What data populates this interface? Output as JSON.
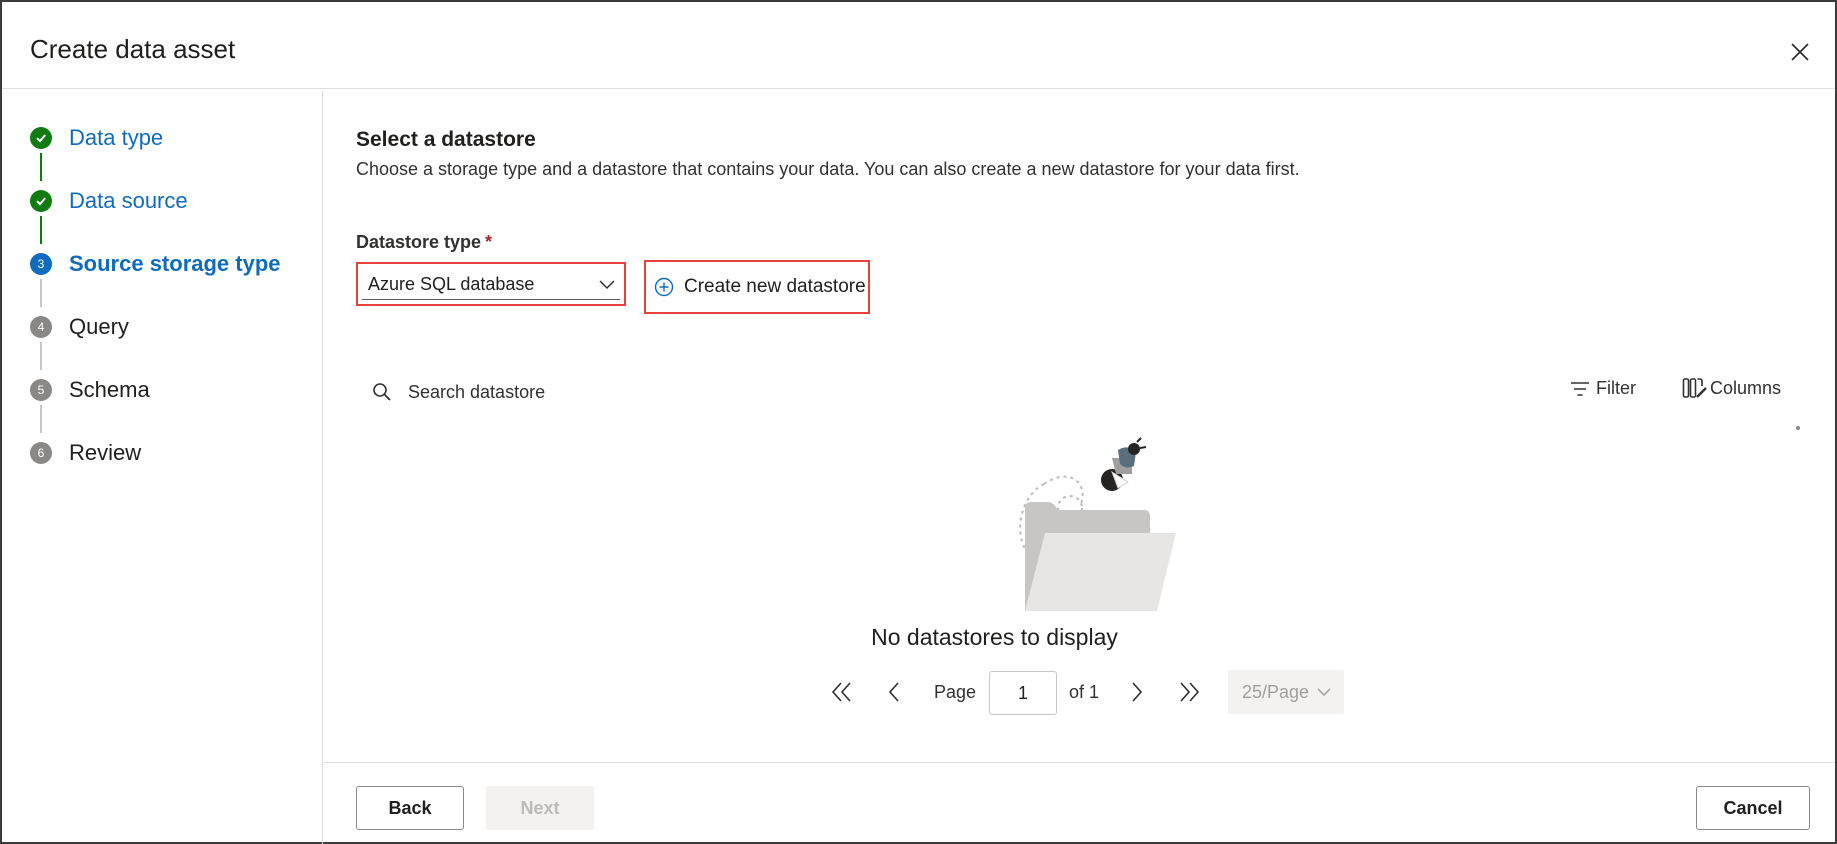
{
  "dialog": {
    "title": "Create data asset"
  },
  "steps": [
    {
      "number": "1",
      "label": "Data type",
      "status": "done"
    },
    {
      "number": "2",
      "label": "Data source",
      "status": "done"
    },
    {
      "number": "3",
      "label": "Source storage type",
      "status": "current"
    },
    {
      "number": "4",
      "label": "Query",
      "status": "todo"
    },
    {
      "number": "5",
      "label": "Schema",
      "status": "todo"
    },
    {
      "number": "6",
      "label": "Review",
      "status": "todo"
    }
  ],
  "main": {
    "section_title": "Select a datastore",
    "section_desc": "Choose a storage type and a datastore that contains your data. You can also create a new datastore for your data first.",
    "datastore_type_label": "Datastore type",
    "required_mark": "*",
    "datastore_type_value": "Azure SQL database",
    "create_new_label": "Create new datastore",
    "search_placeholder": "Search datastore",
    "filter_label": "Filter",
    "columns_label": "Columns",
    "empty_text": "No datastores to display"
  },
  "pagination": {
    "page_label": "Page",
    "current_page": "1",
    "of_label": "of 1",
    "page_size": "25/Page"
  },
  "footer": {
    "back_label": "Back",
    "next_label": "Next",
    "cancel_label": "Cancel"
  },
  "colors": {
    "accent": "#0f6cbd",
    "success": "#107c10",
    "highlight_border": "#e8413a",
    "required": "#a4262c"
  }
}
